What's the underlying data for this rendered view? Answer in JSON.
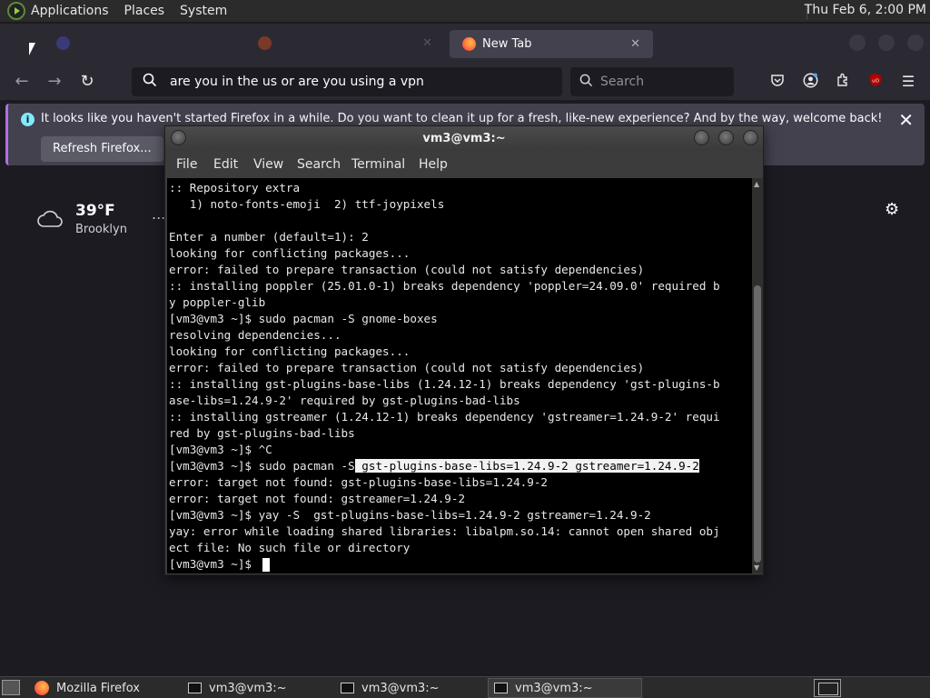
{
  "top_panel": {
    "menus": [
      "Applications",
      "Places",
      "System"
    ],
    "clock": "Thu Feb  6,  2:00 PM"
  },
  "firefox": {
    "tabs": [
      {
        "label": "",
        "active": false
      },
      {
        "label": "",
        "active": false
      },
      {
        "label": "New Tab",
        "active": true
      }
    ],
    "url": "are you in the us or are you using a vpn",
    "search_placeholder": "Search",
    "notice": {
      "message": "It looks like you haven't started Firefox in a while. Do you want to clean it up for a fresh, like-new experience? And by the way, welcome back!",
      "button": "Refresh Firefox..."
    },
    "weather": {
      "temp": "39°F",
      "city": "Brooklyn",
      "more": "..."
    }
  },
  "terminal": {
    "title": "vm3@vm3:~",
    "menu": [
      "File",
      "Edit",
      "View",
      "Search",
      "Terminal",
      "Help"
    ],
    "lines": [
      ":: Repository extra",
      "   1) noto-fonts-emoji  2) ttf-joypixels",
      "",
      "Enter a number (default=1): 2",
      "looking for conflicting packages...",
      "error: failed to prepare transaction (could not satisfy dependencies)",
      ":: installing poppler (25.01.0-1) breaks dependency 'poppler=24.09.0' required b",
      "y poppler-glib",
      "[vm3@vm3 ~]$ sudo pacman -S gnome-boxes",
      "resolving dependencies...",
      "looking for conflicting packages...",
      "error: failed to prepare transaction (could not satisfy dependencies)",
      ":: installing gst-plugins-base-libs (1.24.12-1) breaks dependency 'gst-plugins-b",
      "ase-libs=1.24.9-2' required by gst-plugins-bad-libs",
      ":: installing gstreamer (1.24.12-1) breaks dependency 'gstreamer=1.24.9-2' requi",
      "red by gst-plugins-bad-libs",
      "[vm3@vm3 ~]$ ^C"
    ],
    "line_selected_prefix": "[vm3@vm3 ~]$ sudo pacman -S",
    "line_selected_text": " gst-plugins-base-libs=1.24.9-2 gstreamer=1.24.9-2",
    "lines_after": [
      "error: target not found: gst-plugins-base-libs=1.24.9-2",
      "error: target not found: gstreamer=1.24.9-2",
      "[vm3@vm3 ~]$ yay -S  gst-plugins-base-libs=1.24.9-2 gstreamer=1.24.9-2",
      "yay: error while loading shared libraries: libalpm.so.14: cannot open shared obj",
      "ect file: No such file or directory"
    ],
    "prompt": "[vm3@vm3 ~]$ "
  },
  "taskbar": {
    "items": [
      "Mozilla Firefox",
      "vm3@vm3:~",
      "vm3@vm3:~",
      "vm3@vm3:~"
    ]
  }
}
